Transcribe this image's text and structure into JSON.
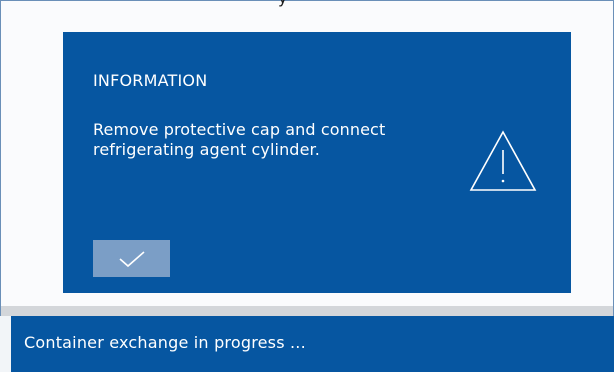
{
  "screen": {
    "top_title_fragment": "y"
  },
  "dialog": {
    "heading": "INFORMATION",
    "message": "Remove protective cap and connect refrigerating agent cylinder.",
    "warning_icon": "warning-triangle-icon",
    "confirm_icon": "checkmark-icon"
  },
  "status_bar": {
    "text": "Container exchange in progress ..."
  },
  "colors": {
    "dialog_background": "#0656a1",
    "button_background": "#7b9ec6",
    "divider": "#d3d6da"
  }
}
